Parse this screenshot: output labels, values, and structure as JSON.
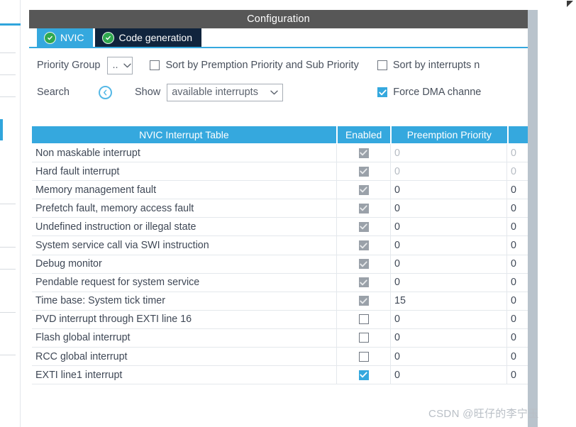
{
  "window": {
    "title": "Configuration"
  },
  "tabs": [
    {
      "label": "NVIC",
      "icon": "check-circle-icon",
      "active": true
    },
    {
      "label": "Code generation",
      "icon": "check-circle-icon",
      "active": false
    }
  ],
  "options": {
    "priority_group_label": "Priority Group",
    "priority_group_value": "..",
    "sort_preemption_label": "Sort by Premption Priority and Sub Priority",
    "sort_preemption_checked": false,
    "sort_interrupts_label": "Sort by interrupts n",
    "sort_interrupts_checked": false,
    "search_label": "Search",
    "search_icon": "circle-chevron-left-icon",
    "show_label": "Show",
    "show_value": "available interrupts",
    "force_dma_label": "Force DMA channe",
    "force_dma_checked": true
  },
  "table": {
    "headers": {
      "name": "NVIC Interrupt Table",
      "enabled": "Enabled",
      "preemption": "Preemption Priority",
      "sub": ""
    },
    "rows": [
      {
        "name": "Non maskable interrupt",
        "enabled": "locked",
        "preemption": "0",
        "sub": "0",
        "dim": true
      },
      {
        "name": "Hard fault interrupt",
        "enabled": "locked",
        "preemption": "0",
        "sub": "0",
        "dim": true
      },
      {
        "name": "Memory management fault",
        "enabled": "locked",
        "preemption": "0",
        "sub": "0",
        "dim": false
      },
      {
        "name": "Prefetch fault, memory access fault",
        "enabled": "locked",
        "preemption": "0",
        "sub": "0",
        "dim": false
      },
      {
        "name": "Undefined instruction or illegal state",
        "enabled": "locked",
        "preemption": "0",
        "sub": "0",
        "dim": false
      },
      {
        "name": "System service call via SWI instruction",
        "enabled": "locked",
        "preemption": "0",
        "sub": "0",
        "dim": false
      },
      {
        "name": "Debug monitor",
        "enabled": "locked",
        "preemption": "0",
        "sub": "0",
        "dim": false
      },
      {
        "name": "Pendable request for system service",
        "enabled": "locked",
        "preemption": "0",
        "sub": "0",
        "dim": false
      },
      {
        "name": "Time base: System tick timer",
        "enabled": "locked",
        "preemption": "15",
        "sub": "0",
        "dim": false
      },
      {
        "name": "PVD interrupt through EXTI line 16",
        "enabled": "unchecked",
        "preemption": "0",
        "sub": "0",
        "dim": false
      },
      {
        "name": "Flash global interrupt",
        "enabled": "unchecked",
        "preemption": "0",
        "sub": "0",
        "dim": false
      },
      {
        "name": "RCC global interrupt",
        "enabled": "unchecked",
        "preemption": "0",
        "sub": "0",
        "dim": false
      },
      {
        "name": "EXTI line1 interrupt",
        "enabled": "checked",
        "preemption": "0",
        "sub": "0",
        "dim": false
      }
    ]
  },
  "watermark": {
    "text": "CSDN @旺仔的李宁玉"
  },
  "colors": {
    "accent": "#35a8de",
    "titlebar": "#575757",
    "tab_inactive": "#10243d",
    "check_green": "#2fa84f",
    "locked_checkbox": "#9aa1a9"
  }
}
